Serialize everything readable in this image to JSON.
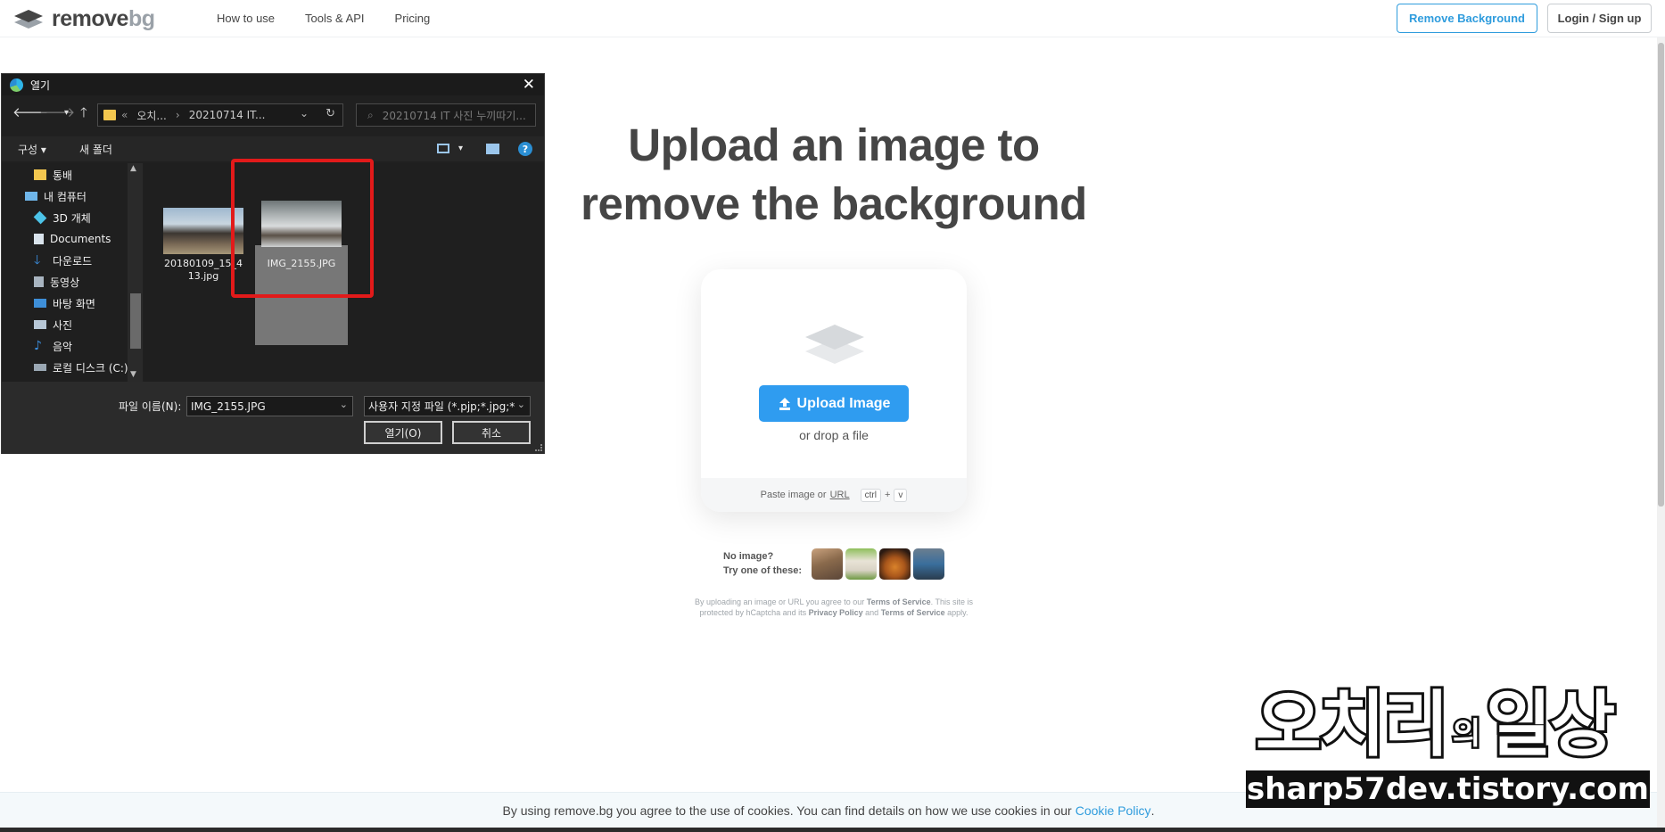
{
  "header": {
    "logo_main": "remove",
    "logo_accent": "bg",
    "nav": [
      "How to use",
      "Tools & API",
      "Pricing"
    ],
    "remove_bg_button": "Remove Background",
    "login_button": "Login / Sign up"
  },
  "hero": {
    "title_line1": "Upload an image to",
    "title_line2": "remove the background"
  },
  "upload": {
    "button": "Upload Image",
    "drop_text": "or drop a file",
    "paste_prefix": "Paste image or",
    "paste_url": "URL",
    "key_ctrl": "ctrl",
    "key_plus": "+",
    "key_v": "v"
  },
  "samples": {
    "line1": "No image?",
    "line2": "Try one of these:"
  },
  "legal": {
    "p1": "By uploading an image or URL you agree to our",
    "terms": "Terms of Service",
    "p2": ". This site is protected by hCaptcha and its",
    "privacy": "Privacy Policy",
    "and": "and",
    "terms2": "Terms of Service",
    "apply": "apply."
  },
  "cookie": {
    "text": "By using remove.bg you agree to the use of cookies. You can find details on how we use cookies in our",
    "link": "Cookie Policy",
    "period": "."
  },
  "watermark": {
    "big1": "오치리",
    "small": "의",
    "big2": "일상",
    "url": "sharp57dev.tistory.com"
  },
  "dialog": {
    "title": "열기",
    "address": [
      "오치...",
      "20210714 IT..."
    ],
    "search_placeholder": "20210714 IT 사진 누끼따기...",
    "toolbar": {
      "organize": "구성",
      "new_folder": "새 폴더"
    },
    "nav_items": [
      {
        "label": "통배",
        "icon": "folder-icon"
      },
      {
        "label": "내 컴퓨터",
        "icon": "computer-icon"
      },
      {
        "label": "3D 개체",
        "icon": "3d-objects-icon"
      },
      {
        "label": "Documents",
        "icon": "documents-icon"
      },
      {
        "label": "다운로드",
        "icon": "download-icon"
      },
      {
        "label": "동영상",
        "icon": "video-icon"
      },
      {
        "label": "바탕 화면",
        "icon": "desktop-icon"
      },
      {
        "label": "사진",
        "icon": "pictures-icon"
      },
      {
        "label": "음악",
        "icon": "music-icon"
      },
      {
        "label": "로컬 디스크 (C:)",
        "icon": "disk-icon"
      }
    ],
    "files": [
      {
        "name_line1": "20180109_15_4",
        "name_line2": "13.jpg"
      },
      {
        "name_line1": "IMG_2155.JPG",
        "name_line2": ""
      }
    ],
    "filename_label": "파일 이름(N):",
    "filename_value": "IMG_2155.JPG",
    "filetype_value": "사용자 지정 파일 (*.pjp;*.jpg;*.",
    "open_button": "열기(O)",
    "cancel_button": "취소"
  }
}
